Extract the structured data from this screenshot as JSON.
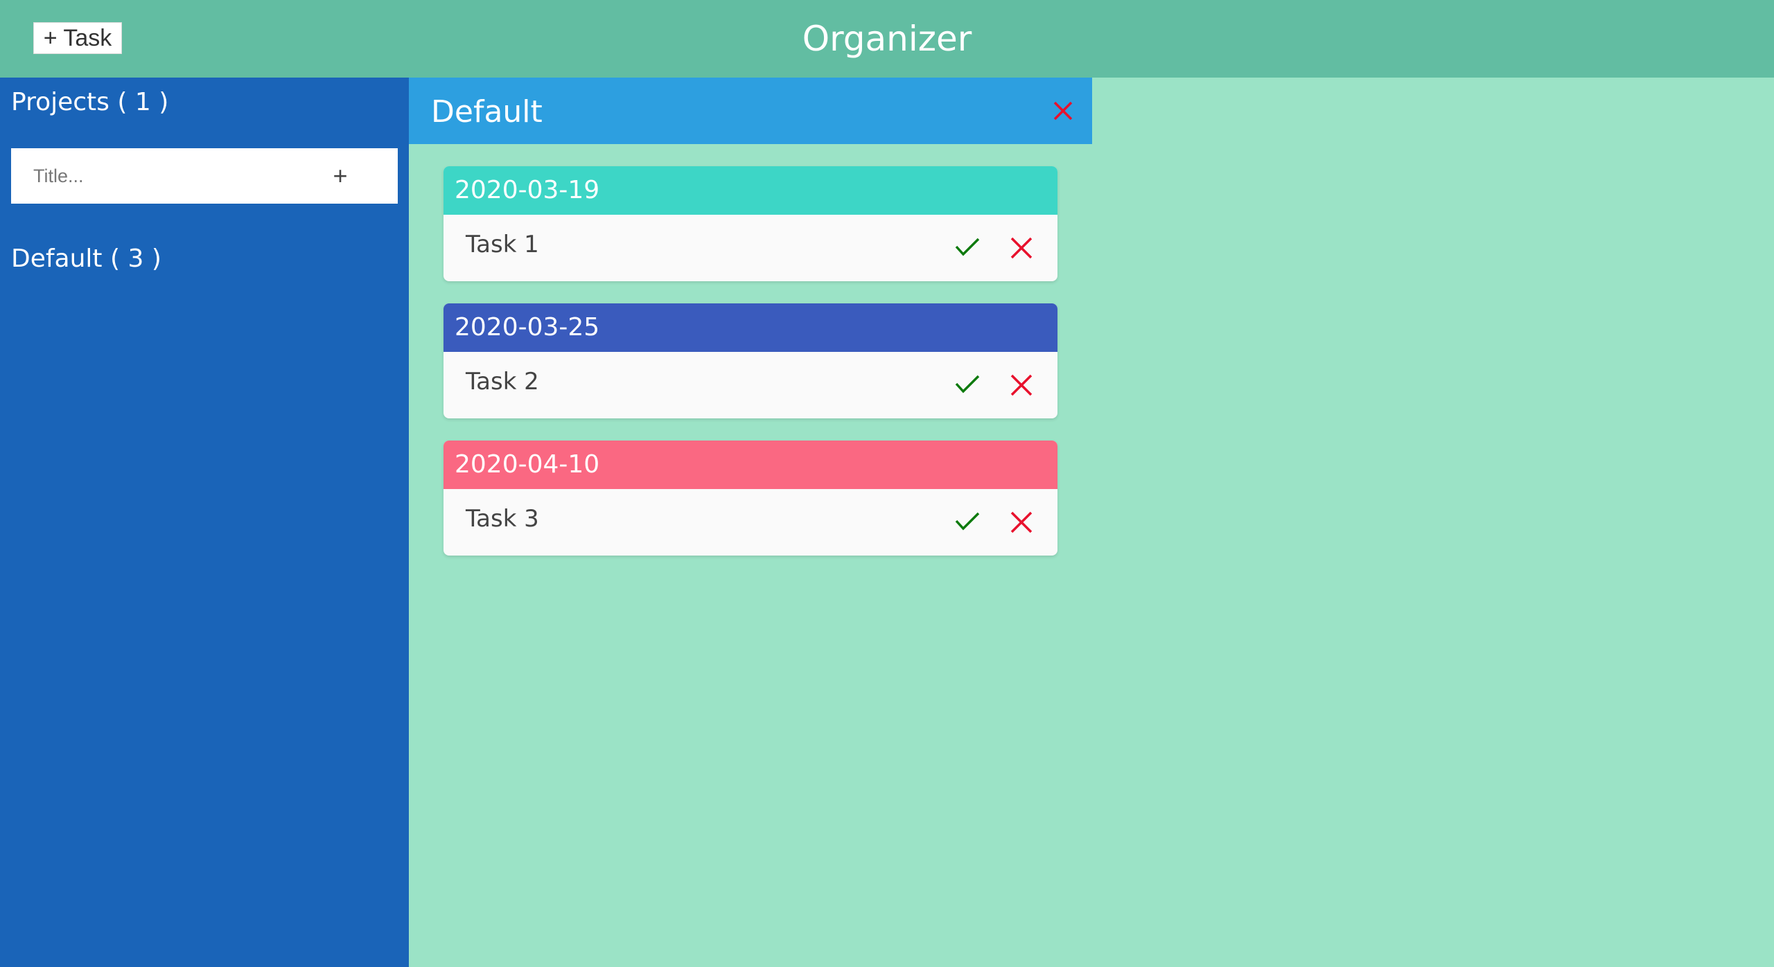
{
  "header": {
    "add_task_label": "+ Task",
    "app_title": "Organizer"
  },
  "sidebar": {
    "projects_heading": "Projects ( 1 )",
    "new_project": {
      "placeholder": "Title...",
      "value": "",
      "add_label": "+"
    },
    "projects": [
      {
        "label": "Default ( 3 )"
      }
    ]
  },
  "project_panel": {
    "title": "Default",
    "tasks": [
      {
        "date": "2020-03-19",
        "name": "Task 1",
        "color": "#3dd6c6"
      },
      {
        "date": "2020-03-25",
        "name": "Task 2",
        "color": "#3a5bbd"
      },
      {
        "date": "2020-04-10",
        "name": "Task 3",
        "color": "#fa6882"
      }
    ]
  },
  "colors": {
    "header_bg": "#62bda2",
    "sidebar_bg": "#1a64b8",
    "panel_header_bg": "#2d9fe0",
    "page_bg": "#9be3c6",
    "check": "#0e7a0e",
    "delete": "#e8112d"
  },
  "icons": {
    "complete": "check-icon",
    "delete": "close-icon"
  }
}
